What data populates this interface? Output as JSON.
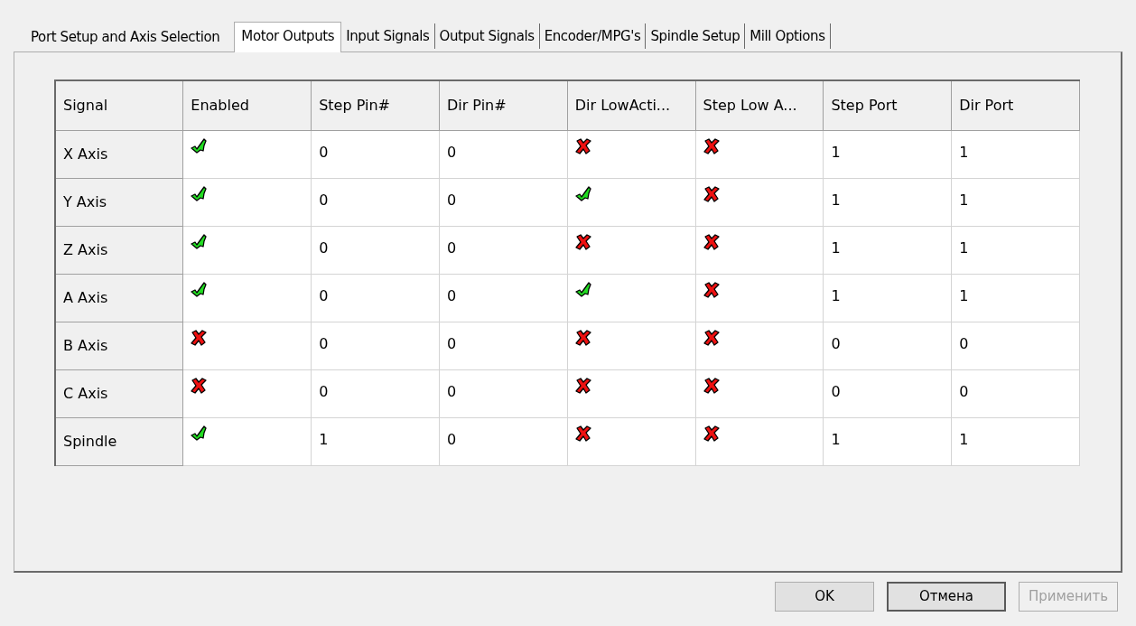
{
  "tabs": [
    {
      "label": "Port Setup and Axis Selection",
      "selected": false
    },
    {
      "label": "Motor Outputs",
      "selected": true
    },
    {
      "label": "Input Signals",
      "selected": false
    },
    {
      "label": "Output Signals",
      "selected": false
    },
    {
      "label": "Encoder/MPG's",
      "selected": false
    },
    {
      "label": "Spindle Setup",
      "selected": false
    },
    {
      "label": "Mill Options",
      "selected": false
    }
  ],
  "table": {
    "columns": [
      "Signal",
      "Enabled",
      "Step Pin#",
      "Dir Pin#",
      "Dir LowActi...",
      "Step Low A...",
      "Step Port",
      "Dir Port"
    ],
    "rows": [
      {
        "signal": "X Axis",
        "enabled": true,
        "step_pin": "0",
        "dir_pin": "0",
        "dir_low_active": false,
        "step_low_active": false,
        "step_port": "1",
        "dir_port": "1"
      },
      {
        "signal": "Y Axis",
        "enabled": true,
        "step_pin": "0",
        "dir_pin": "0",
        "dir_low_active": true,
        "step_low_active": false,
        "step_port": "1",
        "dir_port": "1"
      },
      {
        "signal": "Z Axis",
        "enabled": true,
        "step_pin": "0",
        "dir_pin": "0",
        "dir_low_active": false,
        "step_low_active": false,
        "step_port": "1",
        "dir_port": "1"
      },
      {
        "signal": "A Axis",
        "enabled": true,
        "step_pin": "0",
        "dir_pin": "0",
        "dir_low_active": true,
        "step_low_active": false,
        "step_port": "1",
        "dir_port": "1"
      },
      {
        "signal": "B Axis",
        "enabled": false,
        "step_pin": "0",
        "dir_pin": "0",
        "dir_low_active": false,
        "step_low_active": false,
        "step_port": "0",
        "dir_port": "0"
      },
      {
        "signal": "C Axis",
        "enabled": false,
        "step_pin": "0",
        "dir_pin": "0",
        "dir_low_active": false,
        "step_low_active": false,
        "step_port": "0",
        "dir_port": "0"
      },
      {
        "signal": "Spindle",
        "enabled": true,
        "step_pin": "1",
        "dir_pin": "0",
        "dir_low_active": false,
        "step_low_active": false,
        "step_port": "1",
        "dir_port": "1"
      }
    ]
  },
  "buttons": [
    {
      "label": "OK",
      "default": false,
      "disabled": false
    },
    {
      "label": "Отмена",
      "default": true,
      "disabled": false
    },
    {
      "label": "Применить",
      "default": false,
      "disabled": true
    }
  ]
}
